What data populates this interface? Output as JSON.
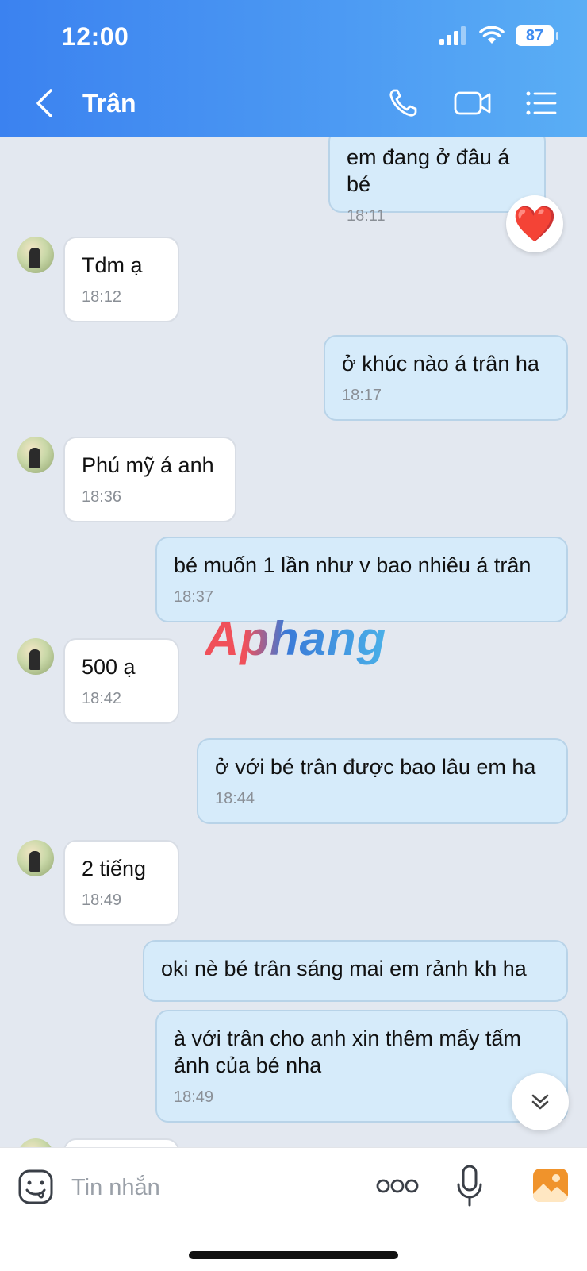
{
  "status": {
    "time": "12:00",
    "battery": "87"
  },
  "header": {
    "title": "Trân"
  },
  "messages": [
    {
      "dir": "out",
      "text": "em đang ở đâu á bé",
      "time": "18:11"
    },
    {
      "dir": "in",
      "text": "Tdm ạ",
      "time": "18:12"
    },
    {
      "dir": "out",
      "text": "ở khúc nào á trân ha",
      "time": "18:17"
    },
    {
      "dir": "in",
      "text": "Phú mỹ á anh",
      "time": "18:36"
    },
    {
      "dir": "out",
      "text": "bé muốn 1 lần như v bao nhiêu á trân",
      "time": "18:37"
    },
    {
      "dir": "in",
      "text": "500 ạ",
      "time": "18:42"
    },
    {
      "dir": "out",
      "text": "ở với bé trân được bao lâu em ha",
      "time": "18:44"
    },
    {
      "dir": "in",
      "text": "2 tiếng",
      "time": "18:49"
    },
    {
      "dir": "out",
      "text": "oki nè bé trân sáng mai em rảnh kh ha",
      "time": ""
    },
    {
      "dir": "out",
      "text": "à với trân cho anh xin thêm mấy tấm\nảnh của bé nha",
      "time": "18:49"
    }
  ],
  "reaction": {
    "emoji": "❤️"
  },
  "watermark": "Aphang",
  "composer": {
    "placeholder": "Tin nhắn"
  },
  "colors": {
    "header_start": "#3b82f0",
    "header_end": "#5aaef5",
    "outgoing_bubble": "#d6ebfa",
    "incoming_bubble": "#ffffff",
    "chat_bg": "#e3e8f0"
  },
  "icons": [
    "back-icon",
    "phone-icon",
    "video-call-icon",
    "menu-list-icon",
    "heart-reaction",
    "chevron-double-down-icon",
    "sticker-icon",
    "more-icon",
    "microphone-icon",
    "image-icon"
  ]
}
